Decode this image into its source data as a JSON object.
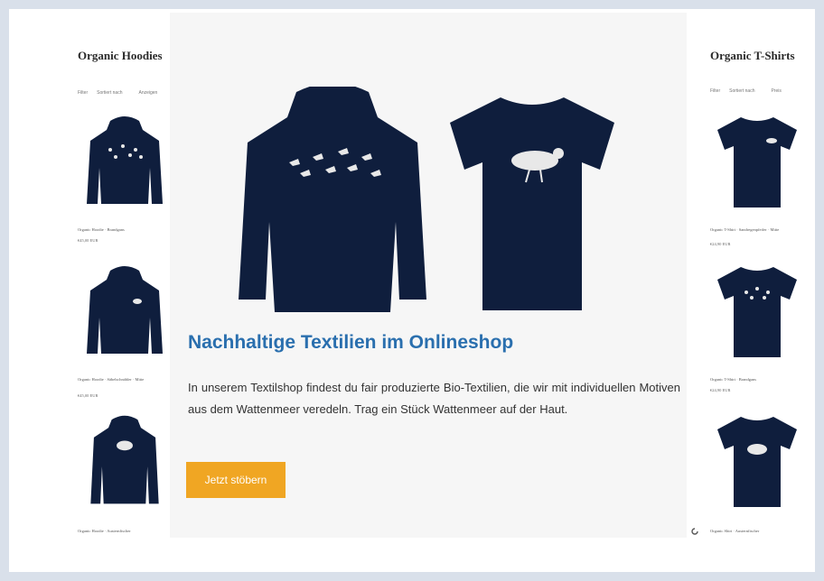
{
  "left": {
    "title": "Organic Hoodies",
    "filters": [
      "Filter",
      "Sortiert nach",
      "Anzeigen"
    ],
    "products": [
      {
        "name": "Organic Hoodie · Brandgans",
        "price": "€45,00 EUR"
      },
      {
        "name": "Organic Hoodie · Säbelschnäbler · Mitte",
        "price": "€45,00 EUR"
      },
      {
        "name": "Organic Hoodie · Austernfischer",
        "price": ""
      }
    ]
  },
  "right": {
    "title": "Organic T-Shirts",
    "filters": [
      "Filter",
      "Sortiert nach",
      "Preis"
    ],
    "products": [
      {
        "name": "Organic T-Shirt · Sandregenpfeifer · Mitte",
        "price": "€24,90 EUR"
      },
      {
        "name": "Organic T-Shirt · Brandgans",
        "price": "€24,90 EUR"
      },
      {
        "name": "Organic Shirt · Austernfischer",
        "price": ""
      }
    ]
  },
  "hero": {
    "headline": "Nachhaltige Textilien im Onlineshop",
    "text": "In unserem Textilshop findest du fair produzierte Bio-Textilien, die wir mit individuellen Motiven aus dem Wattenmeer veredeln. Trag ein Stück Wattenmeer auf der Haut.",
    "cta": "Jetzt stöbern"
  },
  "colors": {
    "accent": "#f0a623",
    "headline": "#2a6fae",
    "garment": "#0f1e3d",
    "print": "#e8e8e8"
  },
  "icons": {
    "spinner": "loading-icon"
  }
}
